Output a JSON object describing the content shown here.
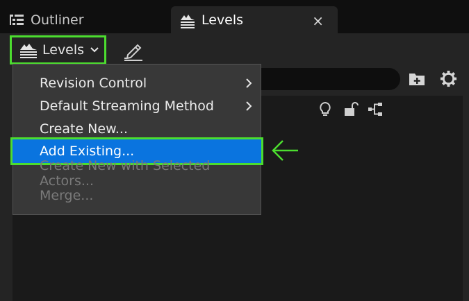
{
  "tabs": [
    {
      "label": "Outliner",
      "icon": "outliner-icon",
      "active": false
    },
    {
      "label": "Levels",
      "icon": "levels-icon",
      "active": true,
      "close_glyph": "×"
    }
  ],
  "toolbar": {
    "levels_button_label": "Levels",
    "levels_button_icon": "levels-icon",
    "edit_icon": "pencil-edit-icon"
  },
  "search": {
    "placeholder": ""
  },
  "header_icons": [
    "lightbulb-icon",
    "unlock-icon",
    "hierarchy-icon",
    "add-folder-icon",
    "gear-icon"
  ],
  "menu": {
    "items": [
      {
        "label": "Revision Control",
        "submenu": true,
        "enabled": true
      },
      {
        "label": "Default Streaming Method",
        "submenu": true,
        "enabled": true
      },
      {
        "label": "Create New...",
        "submenu": false,
        "enabled": true
      },
      {
        "label": "Add Existing...",
        "submenu": false,
        "enabled": true,
        "highlighted": true
      },
      {
        "label": "Create New with Selected Actors...",
        "submenu": false,
        "enabled": false
      },
      {
        "label": "Merge...",
        "submenu": false,
        "enabled": false
      }
    ]
  },
  "colors": {
    "highlight": "#0a74df",
    "annotation_green": "#4cdd2f",
    "panel_bg": "#242424",
    "menu_bg": "#383838"
  }
}
